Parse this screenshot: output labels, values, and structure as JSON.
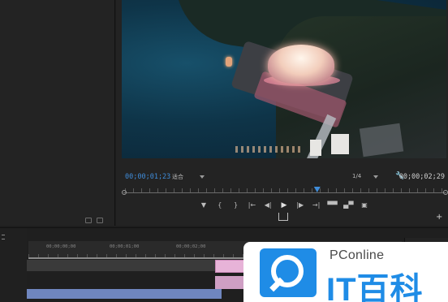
{
  "monitor": {
    "current_timecode": "00;00;01;23",
    "duration_timecode": "00;00;02;29",
    "fit_label": "适合",
    "quality_label": "1/4",
    "playhead_fraction": 0.6
  },
  "transport": {
    "buttons": [
      "mark-in",
      "mark-in-bracket",
      "mark-out-bracket",
      "go-to-in",
      "step-back",
      "play",
      "step-forward",
      "go-to-out",
      "insert",
      "overwrite",
      "export-frame"
    ]
  },
  "timeline": {
    "ruler_labels": [
      "00;00;00;00",
      "00;00;01;00",
      "00;00;02;00"
    ]
  },
  "watermark": {
    "brand": "PConline",
    "name": "IT百科",
    "accent_color": "#1f8ce6"
  }
}
